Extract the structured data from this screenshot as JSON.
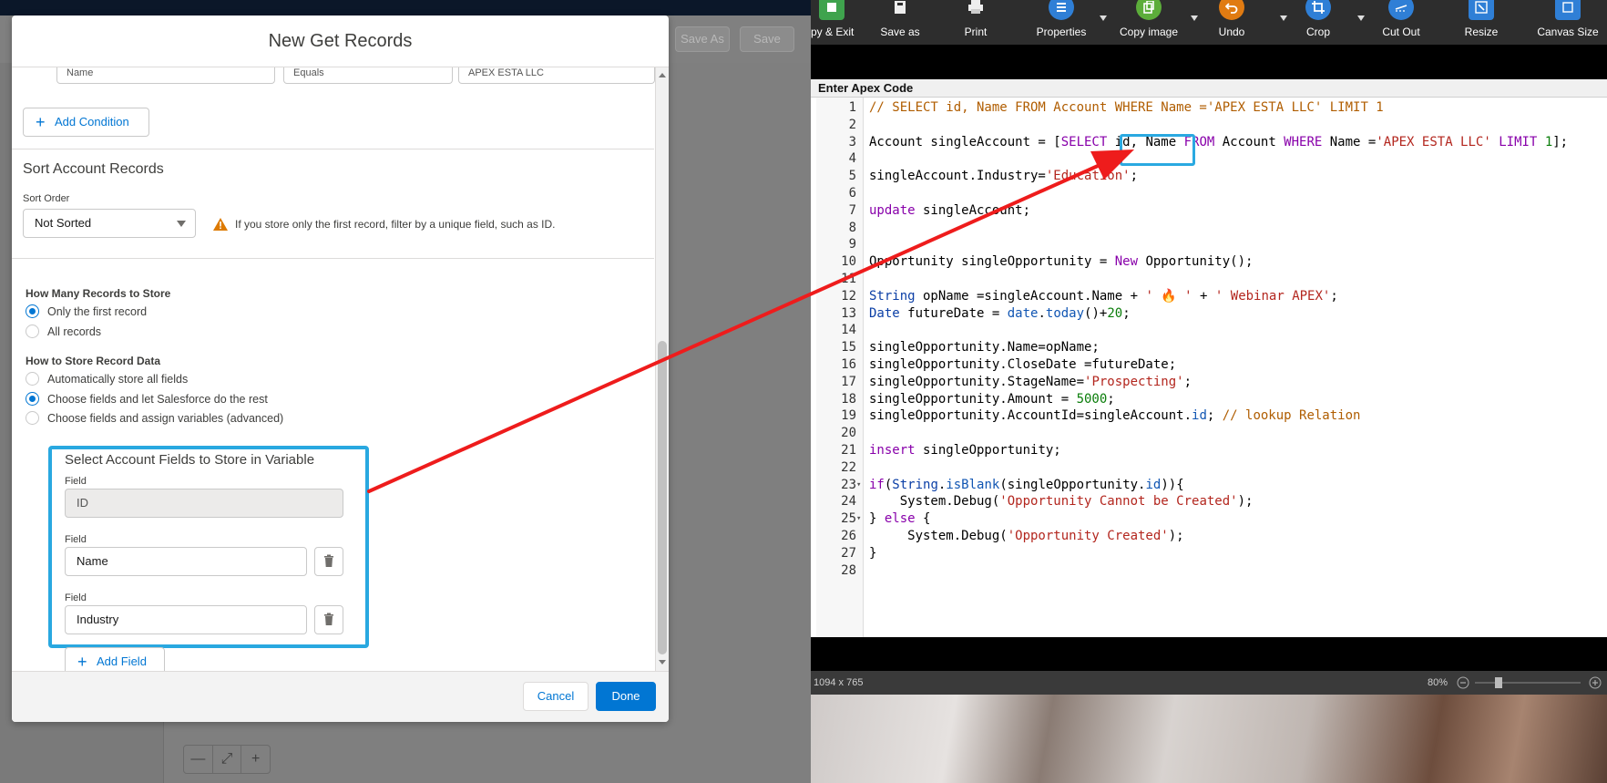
{
  "flow_builder": {
    "top_buttons": [
      "Save As",
      "Save"
    ],
    "zoom_controls": [
      "—",
      "⤢",
      "+"
    ]
  },
  "modal": {
    "title": "New Get Records",
    "condition_row": {
      "field": "Name",
      "operator": "Equals",
      "value": "APEX ESTA LLC"
    },
    "add_condition_label": "Add Condition",
    "sort_section": {
      "title": "Sort Account Records",
      "sort_order_label": "Sort Order",
      "sort_order_value": "Not Sorted",
      "warning": "If you store only the first record, filter by a unique field, such as ID."
    },
    "records_to_store": {
      "title": "How Many Records to Store",
      "options": [
        {
          "label": "Only the first record",
          "checked": true
        },
        {
          "label": "All records",
          "checked": false
        }
      ]
    },
    "store_data": {
      "title": "How to Store Record Data",
      "options": [
        {
          "label": "Automatically store all fields",
          "checked": false
        },
        {
          "label": "Choose fields and let Salesforce do the rest",
          "checked": true
        },
        {
          "label": "Choose fields and assign variables (advanced)",
          "checked": false
        }
      ]
    },
    "fields_section": {
      "title": "Select Account Fields to Store in Variable",
      "field_label": "Field",
      "fields": [
        "ID",
        "Name",
        "Industry"
      ],
      "add_field_label": "Add Field"
    },
    "footer": {
      "cancel": "Cancel",
      "done": "Done"
    }
  },
  "editor": {
    "toolbar": [
      {
        "label": "py & Exit",
        "icon": "save-icon"
      },
      {
        "label": "Save as",
        "icon": "save-as-icon"
      },
      {
        "label": "Print",
        "icon": "printer-icon"
      },
      {
        "label": "Properties",
        "icon": "properties-icon"
      },
      {
        "label": "Copy image",
        "icon": "copy-icon"
      },
      {
        "label": "Undo",
        "icon": "undo-icon"
      },
      {
        "label": "Crop",
        "icon": "crop-icon"
      },
      {
        "label": "Cut Out",
        "icon": "cut-icon"
      },
      {
        "label": "Resize",
        "icon": "resize-icon"
      },
      {
        "label": "Canvas Size",
        "icon": "canvas-icon"
      }
    ],
    "code_title": "Enter Apex Code",
    "code_lines": [
      "// SELECT id, Name FROM Account WHERE Name ='APEX ESTA LLC' LIMIT 1",
      "",
      "Account singleAccount = [SELECT id, Name FROM Account WHERE Name ='APEX ESTA LLC' LIMIT 1];",
      "",
      "singleAccount.Industry='Education';",
      "",
      "update singleAccount;",
      "",
      "",
      "Opportunity singleOpportunity = New Opportunity();",
      "",
      "String opName =singleAccount.Name + ' 🔥 ' + ' Webinar APEX';",
      "Date futureDate = date.today()+20;",
      "",
      "singleOpportunity.Name=opName;",
      "singleOpportunity.CloseDate =futureDate;",
      "singleOpportunity.StageName='Prospecting';",
      "singleOpportunity.Amount = 5000;",
      "singleOpportunity.AccountId=singleAccount.id; // lookup Relation",
      "",
      "insert singleOpportunity;",
      "",
      "if(String.isBlank(singleOpportunity.id)){",
      "    System.Debug('Opportunity Cannot be Created');",
      "} else {",
      "     System.Debug('Opportunity Created');",
      "}",
      ""
    ],
    "status": {
      "dimensions": "1094 x 765",
      "zoom": "80%"
    },
    "colors": {
      "highlight": "#29a8e0",
      "arrow": "#ee1c1c"
    }
  }
}
